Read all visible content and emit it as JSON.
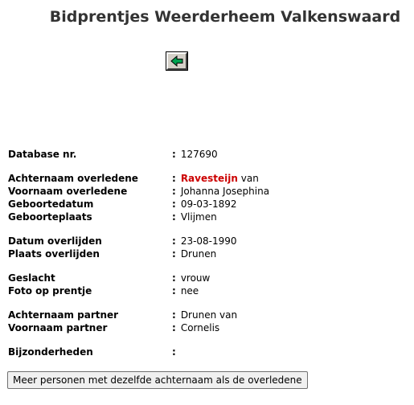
{
  "page": {
    "title": "Bidprentjes Weerderheem Valkenswaard"
  },
  "toolbar": {
    "back_icon": "arrow-left-icon",
    "back_icon_color": "#00a050"
  },
  "record": {
    "colon": ":",
    "database_nr": {
      "label": "Database nr.",
      "value": "127690"
    },
    "achternaam_overledene": {
      "label": "Achternaam overledene",
      "value_surname": "Ravesteijn",
      "value_suffix": "van"
    },
    "voornaam_overledene": {
      "label": "Voornaam overledene",
      "value": "Johanna Josephina"
    },
    "geboortedatum": {
      "label": "Geboortedatum",
      "value": "09-03-1892"
    },
    "geboorteplaats": {
      "label": "Geboorteplaats",
      "value": "Vlijmen"
    },
    "datum_overlijden": {
      "label": "Datum overlijden",
      "value": "23-08-1990"
    },
    "plaats_overlijden": {
      "label": "Plaats overlijden",
      "value": "Drunen"
    },
    "geslacht": {
      "label": "Geslacht",
      "value": "vrouw"
    },
    "foto_op_prentje": {
      "label": "Foto op prentje",
      "value": "nee"
    },
    "achternaam_partner": {
      "label": "Achternaam partner",
      "value": "Drunen van"
    },
    "voornaam_partner": {
      "label": "Voornaam partner",
      "value": "Cornelis"
    },
    "bijzonderheden": {
      "label": "Bijzonderheden",
      "value": ""
    }
  },
  "actions": {
    "more_persons_label": "Meer personen met dezelfde achternaam als de overledene"
  },
  "colors": {
    "title": "#333333",
    "surname_highlight": "#cc0000"
  }
}
